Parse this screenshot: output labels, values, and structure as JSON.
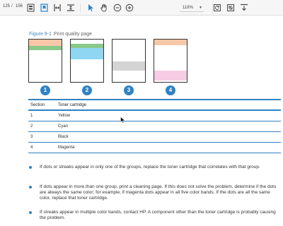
{
  "toolbar": {
    "page_current": "125",
    "page_separator": "/",
    "page_total": "156",
    "zoom": "118%",
    "icons": [
      "thumbnails-icon",
      "bookmark-icon",
      "fit-width-icon",
      "fit-page-icon",
      "select-cursor-icon",
      "hand-tool-icon",
      "zoom-out-icon",
      "zoom-in-icon",
      "zoom-dropdown-icon",
      "rotate-icon",
      "print-icon",
      "download-icon"
    ]
  },
  "figure": {
    "label": "Figure 9-1",
    "title": "Print quality page",
    "numbers": [
      "1",
      "2",
      "3",
      "4"
    ],
    "colors": {
      "orange": "#f8c7a8",
      "green": "#8bc98a",
      "cyan": "#8fd6f2",
      "gray": "#d4d4d4",
      "magenta": "#f6cde4",
      "badge": "#2f82c4"
    }
  },
  "table": {
    "headers": [
      "Section",
      "Toner cartridge"
    ],
    "rows": [
      [
        "1",
        "Yellow"
      ],
      [
        "2",
        "Cyan"
      ],
      [
        "3",
        "Black"
      ],
      [
        "4",
        "Magenta"
      ]
    ]
  },
  "bullets": [
    "If dots or streaks appear in only one of the groups, replace the toner cartridge that correlates with that group.",
    "If dots appear in more than one group, print a cleaning page. If this does not solve the problem, determine if the dots are always the same color; for example, if magenta dots appear in all five color bands. If the dots are all the same color, replace that toner cartridge.",
    "If streaks appear in multiple color bands, contact HP. A component other than the toner cartridge is probably causing the problem."
  ]
}
